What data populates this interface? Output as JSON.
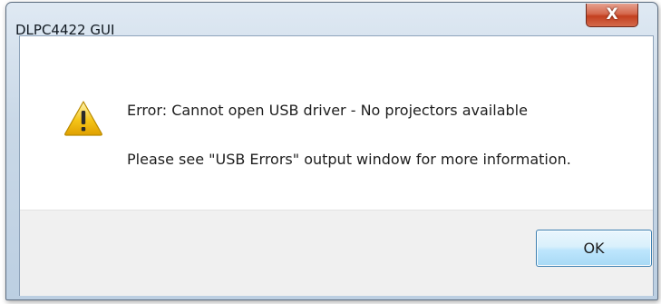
{
  "window": {
    "title": "DLPC4422 GUI",
    "close_glyph": "X"
  },
  "message": {
    "icon": "warning-icon",
    "line1": "Error: Cannot open USB driver - No projectors available",
    "line2": "Please see \"USB Errors\" output window for more information."
  },
  "buttons": {
    "ok_label": "OK"
  },
  "colors": {
    "warning_yellow": "#f5c518",
    "close_red": "#c3401f",
    "ok_border": "#3c7fb1"
  }
}
